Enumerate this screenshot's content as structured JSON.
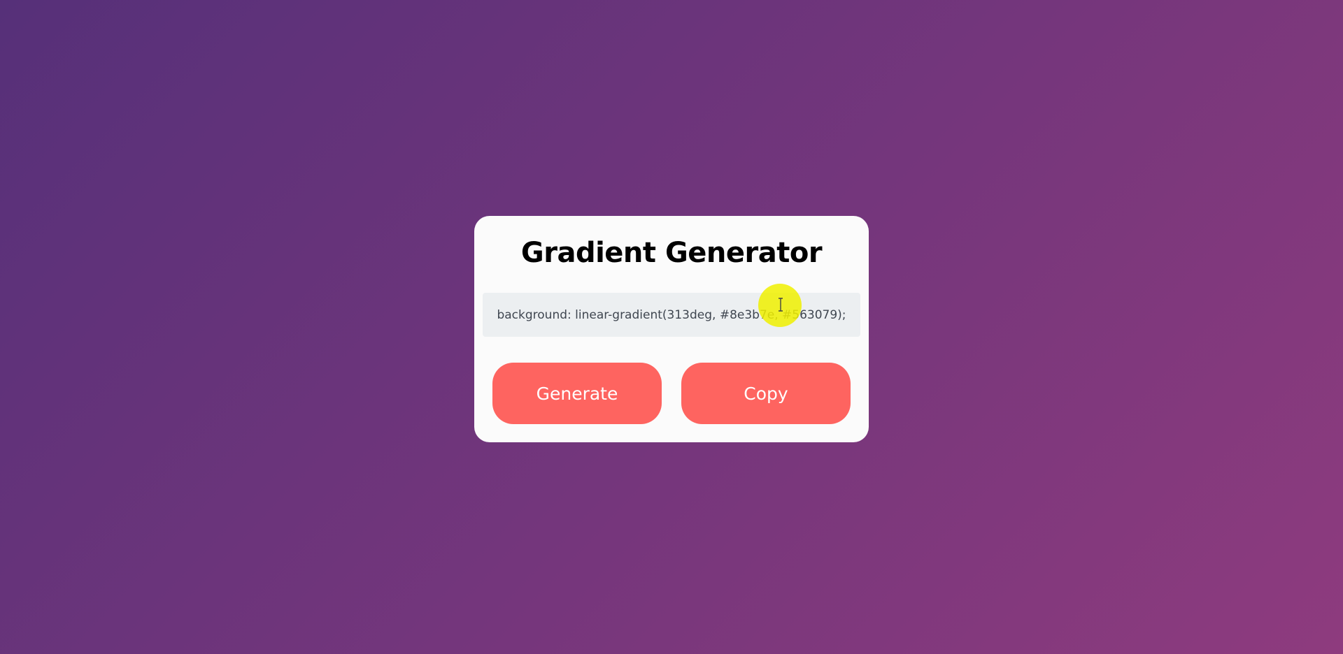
{
  "app": {
    "title": "Gradient Generator"
  },
  "gradient": {
    "css_output": "background: linear-gradient(313deg, #8e3b7e, #563079);",
    "angle": "313deg",
    "color_start": "#8e3b7e",
    "color_end": "#563079"
  },
  "buttons": {
    "generate_label": "Generate",
    "copy_label": "Copy"
  },
  "colors": {
    "button_bg": "#fe6460",
    "card_bg": "#fbfbfb",
    "code_bg": "#eceff1",
    "cursor_highlight": "#f0f000"
  },
  "icons": {
    "cursor": "text-cursor-icon"
  }
}
